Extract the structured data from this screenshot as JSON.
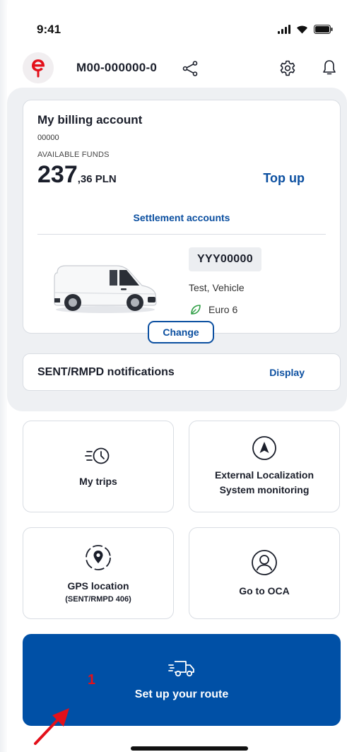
{
  "status_bar": {
    "time": "9:41",
    "icons": [
      "signal-icon",
      "wifi-icon",
      "battery-icon"
    ]
  },
  "header": {
    "logo_letter": "e",
    "account_id": "M00-000000-0",
    "icons": [
      "share-icon",
      "gear-icon",
      "bell-icon"
    ]
  },
  "billing": {
    "title": "My billing account",
    "number": "00000",
    "funds_label": "AVAILABLE FUNDS",
    "amount_whole": "237",
    "amount_fraction": ",36 PLN",
    "top_up_label": "Top up",
    "settlement_label": "Settlement accounts"
  },
  "vehicle": {
    "plate": "YYY00000",
    "name": "Test, Vehicle",
    "emission": "Euro 6",
    "change_label": "Change"
  },
  "notifications": {
    "title": "SENT/RMPD notifications",
    "display_label": "Display"
  },
  "tiles": {
    "my_trips": {
      "label": "My trips",
      "icon": "clock-trips-icon"
    },
    "els": {
      "label_line1": "External Localization",
      "label_line2": "System monitoring",
      "icon": "navigation-arrow-icon"
    },
    "gps": {
      "label": "GPS location",
      "sublabel": "(SENT/RMPD 406)",
      "icon": "location-pin-icon"
    },
    "oca": {
      "label": "Go to OCA",
      "icon": "user-circle-icon"
    }
  },
  "route": {
    "label": "Set up your route",
    "icon": "delivery-truck-icon"
  },
  "annotation": {
    "marker": "1"
  },
  "colors": {
    "brand_red": "#e3101a",
    "link_blue": "#0b4fa0",
    "primary_blue": "#0050a6",
    "background_grey": "#eef0f3"
  }
}
